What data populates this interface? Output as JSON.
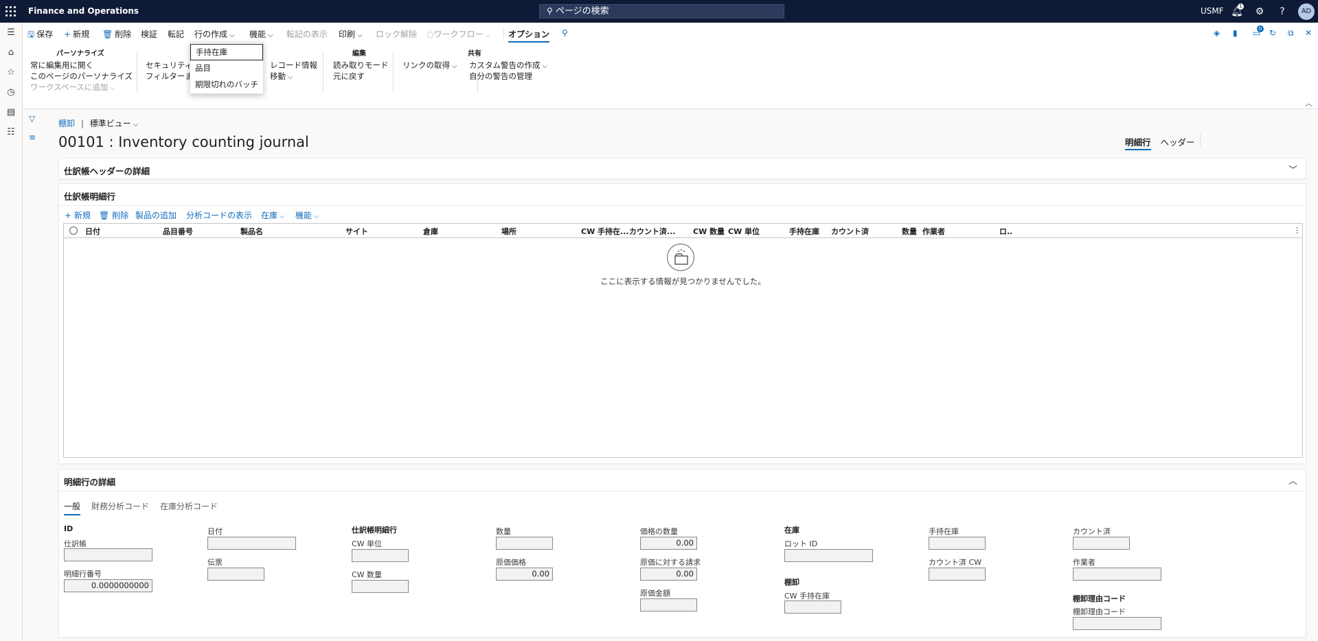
{
  "topbar": {
    "app_name": "Finance and Operations",
    "search_placeholder": "ページの検索",
    "company": "USMF",
    "avatar_initials": "AD",
    "notification_count": "1"
  },
  "actionpane": {
    "save": "保存",
    "new": "新規",
    "delete": "削除",
    "validate": "検証",
    "post": "転記",
    "create_lines": "行の作成",
    "functions": "機能",
    "show_posting": "転記の表示",
    "print": "印刷",
    "unlock": "ロック解除",
    "workflow": "ワークフロー",
    "options": "オプション",
    "badge_count": "0",
    "groups": {
      "personalize": {
        "title": "パーソナライズ",
        "items": [
          "常に編集用に開く",
          "このページのパーソナライズ",
          "ワークスペースに追加"
        ]
      },
      "security": {
        "items": [
          "セキュリティ",
          "フィルターま"
        ]
      },
      "record": {
        "items": [
          "レコード情報",
          "移動"
        ]
      },
      "edit": {
        "title": "編集",
        "items": [
          "読み取りモード",
          "元に戻す"
        ]
      },
      "links": {
        "items": [
          "リンクの取得"
        ]
      },
      "share": {
        "title": "共有",
        "items": [
          "カスタム警告の作成",
          "自分の警告の管理"
        ]
      }
    }
  },
  "dropdown": {
    "items": [
      "手持在庫",
      "品目",
      "期限切れのバッチ"
    ]
  },
  "page": {
    "breadcrumb_link": "棚卸",
    "breadcrumb_sep": "|",
    "view": "標準ビュー",
    "title": "00101 : Inventory counting journal",
    "view_tabs": [
      "明細行",
      "ヘッダー"
    ]
  },
  "header_details": {
    "title": "仕訳帳ヘッダーの詳細"
  },
  "lines": {
    "title": "仕訳帳明細行",
    "toolbar": [
      "新規",
      "削除",
      "製品の追加",
      "分析コードの表示",
      "在庫",
      "機能"
    ],
    "columns": [
      "日付",
      "品目番号",
      "製品名",
      "サイト",
      "倉庫",
      "場所",
      "CW 手持在...",
      "カウント済...",
      "CW 数量",
      "CW 単位",
      "手持在庫",
      "カウント済",
      "数量",
      "作業者",
      "ロ.."
    ],
    "empty_message": "ここに表示する情報が見つかりませんでした。"
  },
  "line_details": {
    "title": "明細行の詳細",
    "tabs": [
      "一般",
      "財務分析コード",
      "在庫分析コード"
    ],
    "col1": {
      "head": "ID",
      "journal_label": "仕訳帳",
      "line_no_label": "明細行番号",
      "line_no_value": "0.0000000000"
    },
    "col2": {
      "date_label": "日付",
      "voucher_label": "伝票"
    },
    "col3": {
      "head": "仕訳帳明細行",
      "cw_unit_label": "CW 単位",
      "cw_qty_label": "CW 数量"
    },
    "col4": {
      "qty_label": "数量",
      "cost_price_label": "原価価格",
      "cost_price_value": "0.00"
    },
    "col5": {
      "price_qty_label": "価格の数量",
      "price_qty_value": "0.00",
      "cost_markup_label": "原価に対する請求",
      "cost_markup_value": "0.00",
      "cost_amount_label": "原価金額"
    },
    "col6": {
      "head": "在庫",
      "lot_label": "ロット ID",
      "counting_head": "棚卸",
      "cw_onhand_label": "CW 手持在庫"
    },
    "col7": {
      "onhand_label": "手持在庫",
      "counted_cw_label": "カウント済 CW"
    },
    "col8": {
      "counted_label": "カウント済",
      "worker_label": "作業者",
      "reason_head": "棚卸理由コード",
      "reason_label": "棚卸理由コード"
    }
  }
}
